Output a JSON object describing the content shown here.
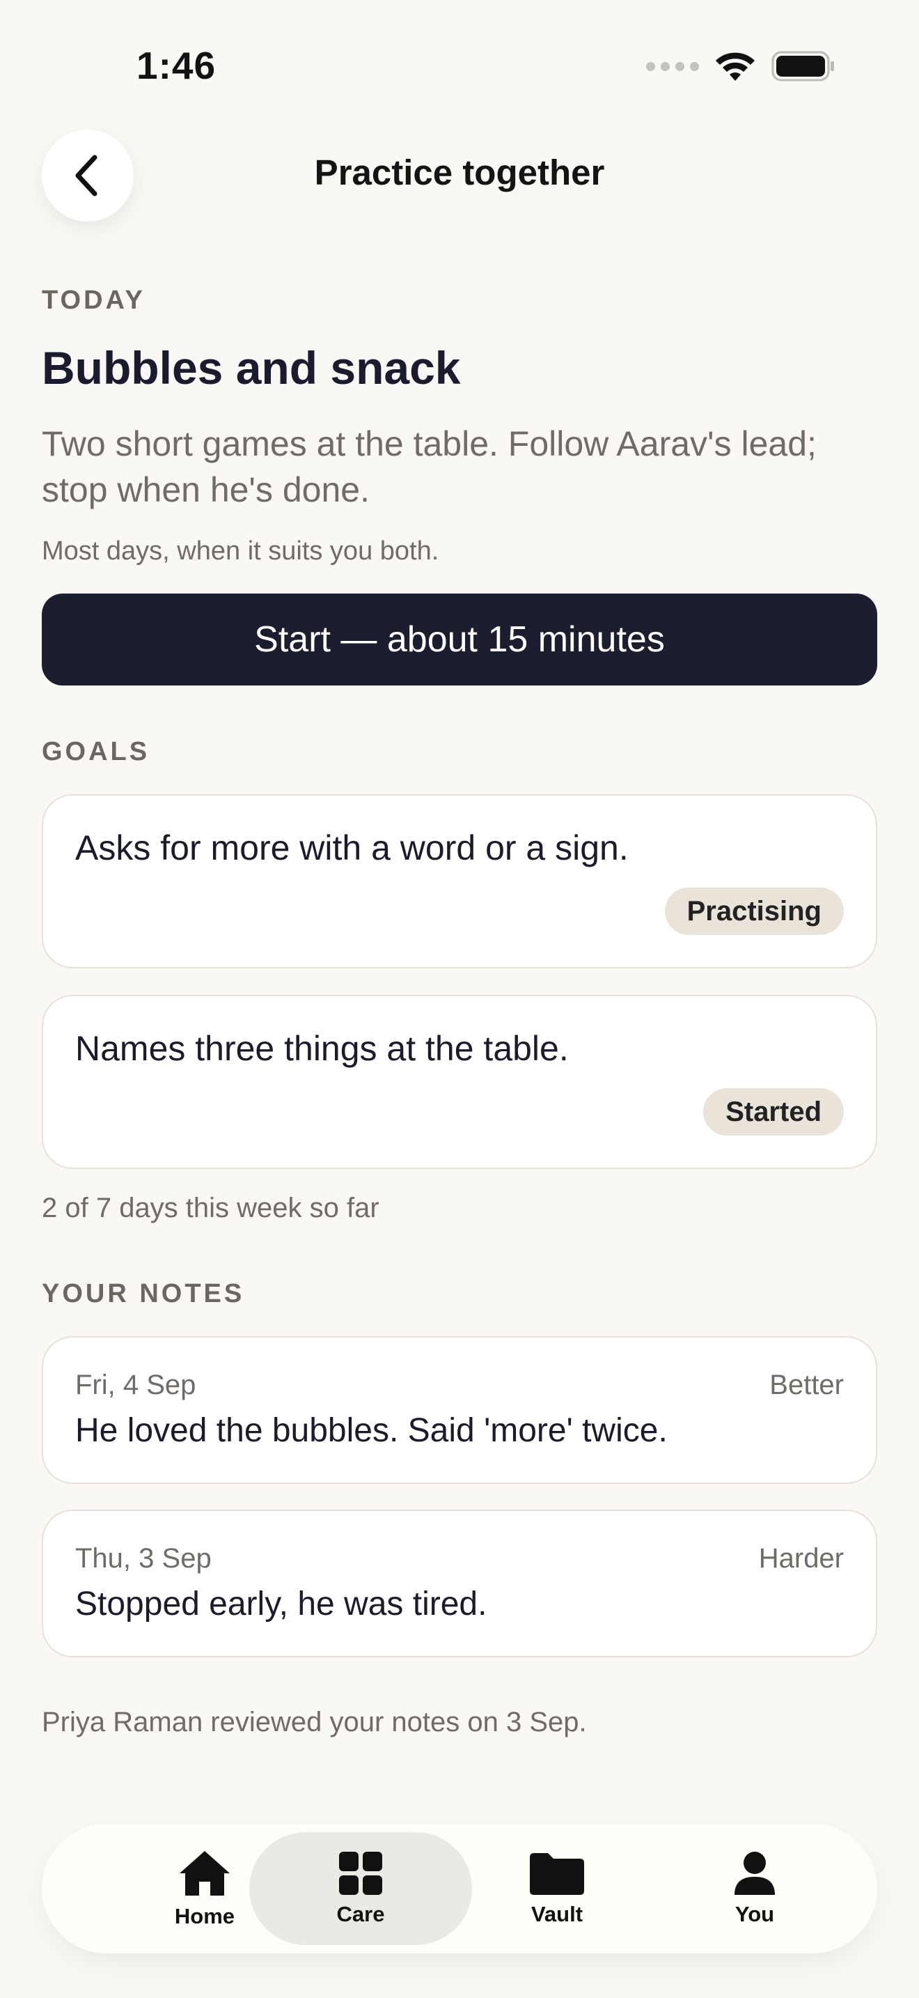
{
  "status_bar": {
    "time": "1:46"
  },
  "header": {
    "title": "Practice together",
    "back_icon": "chevron-left-icon"
  },
  "today": {
    "label": "TODAY",
    "title": "Bubbles and snack",
    "description": "Two short games at the table. Follow Aarav's lead; stop when he's done.",
    "frequency": "Most days, when it suits you both.",
    "start_button": "Start — about 15 minutes"
  },
  "goals": {
    "label": "GOALS",
    "items": [
      {
        "text": "Asks for more with a word or a sign.",
        "status": "Practising"
      },
      {
        "text": "Names three things at the table.",
        "status": "Started"
      }
    ],
    "progress": "2 of 7 days this week so far"
  },
  "notes": {
    "label": "YOUR NOTES",
    "items": [
      {
        "date": "Fri, 4 Sep",
        "rating": "Better",
        "text": "He loved the bubbles. Said 'more' twice."
      },
      {
        "date": "Thu, 3 Sep",
        "rating": "Harder",
        "text": "Stopped early, he was tired."
      }
    ],
    "reviewed": "Priya Raman reviewed your notes on 3 Sep."
  },
  "tab_bar": {
    "active": "Care",
    "tabs": [
      {
        "label": "Home",
        "icon": "home-icon"
      },
      {
        "label": "Care",
        "icon": "grid-icon"
      },
      {
        "label": "Vault",
        "icon": "folder-icon"
      },
      {
        "label": "You",
        "icon": "person-icon"
      }
    ]
  },
  "colors": {
    "background": "#faf8f4",
    "primary_button": "#1d1d30",
    "badge": "#e9e3d9",
    "active_tab": "#ebe9e3"
  }
}
